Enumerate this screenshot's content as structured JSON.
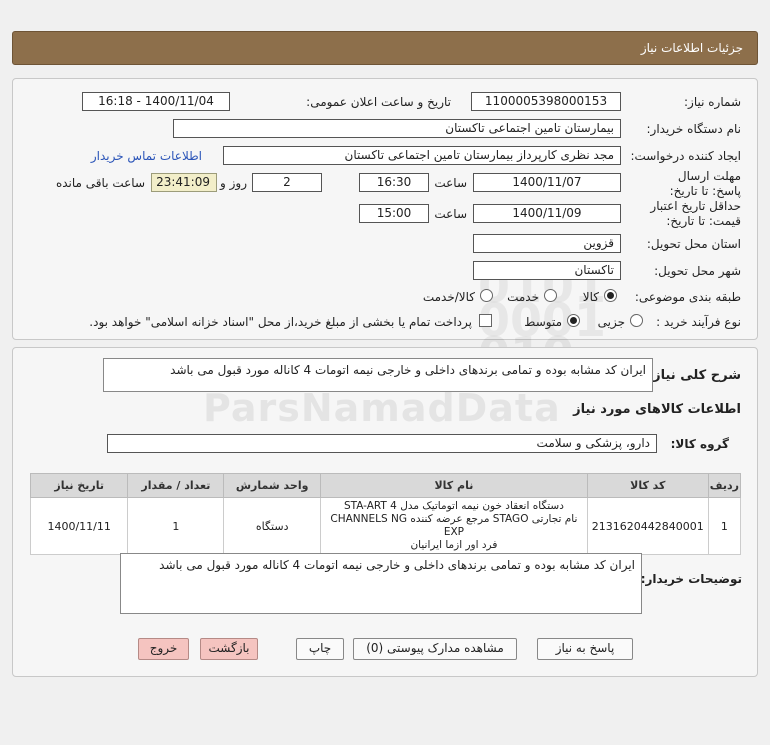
{
  "header": {
    "title": "جزئیات اطلاعات نیاز"
  },
  "form": {
    "need_number_label": "شماره نیاز:",
    "need_number": "1100005398000153",
    "announce_label": "تاریخ و ساعت اعلان عمومی:",
    "announce_value": "1400/11/04 - 16:18",
    "buyer_label": "نام دستگاه خریدار:",
    "buyer_value": "بیمارستان تامین اجتماعی تاکستان",
    "creator_label": "ایجاد کننده درخواست:",
    "creator_value": "مجد نظری کارپرداز بیمارستان تامین اجتماعی تاکستان",
    "contact_link": "اطلاعات تماس خریدار",
    "reply_deadline_label": "مهلت ارسال پاسخ: تا تاریخ:",
    "reply_date": "1400/11/07",
    "time_label": "ساعت",
    "reply_time": "16:30",
    "days_value": "2",
    "days_label": "روز و",
    "remaining_value": "23:41:09",
    "remaining_label": "ساعت باقی مانده",
    "validity_label": "حداقل تاریخ اعتبار قیمت: تا تاریخ:",
    "validity_date": "1400/11/09",
    "validity_time": "15:00",
    "province_label": "استان محل تحویل:",
    "province_value": "قزوین",
    "city_label": "شهر محل تحویل:",
    "city_value": "تاکستان",
    "category_label": "طبقه بندی موضوعی:",
    "category_options": [
      "کالا",
      "خدمت",
      "کالا/خدمت"
    ],
    "purchase_type_label": "نوع فرآیند خرید :",
    "purchase_options": [
      "جزیی",
      "متوسط"
    ],
    "payment_note": "پرداخت تمام یا بخشی از مبلغ خرید،از محل \"اسناد خزانه اسلامی\" خواهد بود."
  },
  "details": {
    "summary_label": "شرح کلی نیاز:",
    "summary_value": "ایران کد مشابه بوده و تمامی برندهای داخلی و خارجی نیمه اتومات 4 کاناله مورد قبول می باشد",
    "goods_info_title": "اطلاعات کالاهای مورد نیاز",
    "goods_group_label": "گروه کالا:",
    "goods_group_value": "دارو، پزشکی و سلامت",
    "table": {
      "headers": [
        "ردیف",
        "کد کالا",
        "نام کالا",
        "واحد شمارش",
        "تعداد / مقدار",
        "تاریخ نیاز"
      ],
      "rows": [
        {
          "row": "1",
          "code": "2131620442840001",
          "name_line1": "دستگاه انعقاد خون نیمه اتوماتیک مدل STA-ART 4",
          "name_line2": "نام تجارتی STAGO مرجع عرضه کننده CHANNELS NG EXP",
          "name_line3": "فرد اور ازما ایرانیان",
          "unit": "دستگاه",
          "qty": "1",
          "date": "1400/11/11"
        }
      ]
    },
    "buyer_notes_label": "توضیحات خریدار:",
    "buyer_notes_value": "ایران کد مشابه بوده و تمامی برندهای داخلی و خارجی نیمه اتومات 4 کاناله مورد قبول می باشد"
  },
  "buttons": {
    "reply": "پاسخ به نیاز",
    "attachments": "مشاهده مدارک پیوستی (0)",
    "print": "چاپ",
    "back": "بازگشت",
    "exit": "خروج"
  }
}
